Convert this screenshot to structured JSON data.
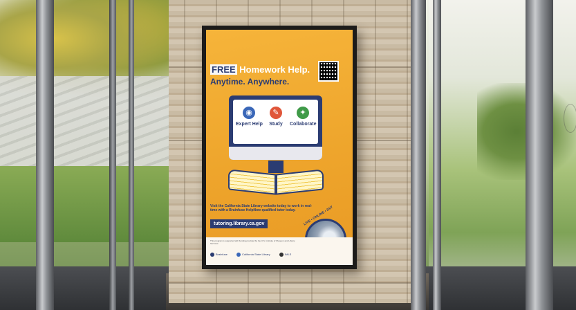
{
  "scene": {
    "description_colors": {
      "poster_background": "#f0a830",
      "poster_navy": "#2b3c72",
      "stone": "#c7b79e",
      "frame": "#1c1b1a"
    }
  },
  "poster": {
    "headline_free": "FREE",
    "headline_rest": " Homework Help.",
    "headline_line2": "Anytime. Anywhere.",
    "qr_icon": "qr-code-icon",
    "features": [
      {
        "label": "Expert Help",
        "icon": "globe-icon",
        "color": "#3a67b8"
      },
      {
        "label": "Study",
        "icon": "study-icon",
        "color": "#e0563a"
      },
      {
        "label": "Collaborate",
        "icon": "collaborate-icon",
        "color": "#3f9a48"
      }
    ],
    "body_text": "Visit the California State Library website today to work in real-time with a Brainfuse HelpNow qualified tutor today.",
    "url": "tutoring.library.ca.gov",
    "badge": "LIVE • ONLINE • 24/7",
    "fine_print": "This program is supported with funding provided by the U.S. Institute of Museum and Library Services.",
    "logos": [
      {
        "label": "Brainfuse",
        "color": "#2b3c72"
      },
      {
        "label": "California State Library",
        "color": "#3a67b8"
      },
      {
        "label": "IMLS",
        "color": "#333333"
      }
    ]
  }
}
